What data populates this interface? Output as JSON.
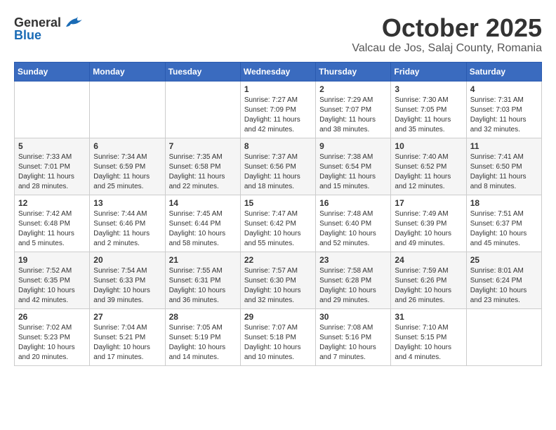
{
  "header": {
    "logo_general": "General",
    "logo_blue": "Blue",
    "month": "October 2025",
    "location": "Valcau de Jos, Salaj County, Romania"
  },
  "weekdays": [
    "Sunday",
    "Monday",
    "Tuesday",
    "Wednesday",
    "Thursday",
    "Friday",
    "Saturday"
  ],
  "weeks": [
    [
      {
        "day": "",
        "info": ""
      },
      {
        "day": "",
        "info": ""
      },
      {
        "day": "",
        "info": ""
      },
      {
        "day": "1",
        "info": "Sunrise: 7:27 AM\nSunset: 7:09 PM\nDaylight: 11 hours\nand 42 minutes."
      },
      {
        "day": "2",
        "info": "Sunrise: 7:29 AM\nSunset: 7:07 PM\nDaylight: 11 hours\nand 38 minutes."
      },
      {
        "day": "3",
        "info": "Sunrise: 7:30 AM\nSunset: 7:05 PM\nDaylight: 11 hours\nand 35 minutes."
      },
      {
        "day": "4",
        "info": "Sunrise: 7:31 AM\nSunset: 7:03 PM\nDaylight: 11 hours\nand 32 minutes."
      }
    ],
    [
      {
        "day": "5",
        "info": "Sunrise: 7:33 AM\nSunset: 7:01 PM\nDaylight: 11 hours\nand 28 minutes."
      },
      {
        "day": "6",
        "info": "Sunrise: 7:34 AM\nSunset: 6:59 PM\nDaylight: 11 hours\nand 25 minutes."
      },
      {
        "day": "7",
        "info": "Sunrise: 7:35 AM\nSunset: 6:58 PM\nDaylight: 11 hours\nand 22 minutes."
      },
      {
        "day": "8",
        "info": "Sunrise: 7:37 AM\nSunset: 6:56 PM\nDaylight: 11 hours\nand 18 minutes."
      },
      {
        "day": "9",
        "info": "Sunrise: 7:38 AM\nSunset: 6:54 PM\nDaylight: 11 hours\nand 15 minutes."
      },
      {
        "day": "10",
        "info": "Sunrise: 7:40 AM\nSunset: 6:52 PM\nDaylight: 11 hours\nand 12 minutes."
      },
      {
        "day": "11",
        "info": "Sunrise: 7:41 AM\nSunset: 6:50 PM\nDaylight: 11 hours\nand 8 minutes."
      }
    ],
    [
      {
        "day": "12",
        "info": "Sunrise: 7:42 AM\nSunset: 6:48 PM\nDaylight: 11 hours\nand 5 minutes."
      },
      {
        "day": "13",
        "info": "Sunrise: 7:44 AM\nSunset: 6:46 PM\nDaylight: 11 hours\nand 2 minutes."
      },
      {
        "day": "14",
        "info": "Sunrise: 7:45 AM\nSunset: 6:44 PM\nDaylight: 10 hours\nand 58 minutes."
      },
      {
        "day": "15",
        "info": "Sunrise: 7:47 AM\nSunset: 6:42 PM\nDaylight: 10 hours\nand 55 minutes."
      },
      {
        "day": "16",
        "info": "Sunrise: 7:48 AM\nSunset: 6:40 PM\nDaylight: 10 hours\nand 52 minutes."
      },
      {
        "day": "17",
        "info": "Sunrise: 7:49 AM\nSunset: 6:39 PM\nDaylight: 10 hours\nand 49 minutes."
      },
      {
        "day": "18",
        "info": "Sunrise: 7:51 AM\nSunset: 6:37 PM\nDaylight: 10 hours\nand 45 minutes."
      }
    ],
    [
      {
        "day": "19",
        "info": "Sunrise: 7:52 AM\nSunset: 6:35 PM\nDaylight: 10 hours\nand 42 minutes."
      },
      {
        "day": "20",
        "info": "Sunrise: 7:54 AM\nSunset: 6:33 PM\nDaylight: 10 hours\nand 39 minutes."
      },
      {
        "day": "21",
        "info": "Sunrise: 7:55 AM\nSunset: 6:31 PM\nDaylight: 10 hours\nand 36 minutes."
      },
      {
        "day": "22",
        "info": "Sunrise: 7:57 AM\nSunset: 6:30 PM\nDaylight: 10 hours\nand 32 minutes."
      },
      {
        "day": "23",
        "info": "Sunrise: 7:58 AM\nSunset: 6:28 PM\nDaylight: 10 hours\nand 29 minutes."
      },
      {
        "day": "24",
        "info": "Sunrise: 7:59 AM\nSunset: 6:26 PM\nDaylight: 10 hours\nand 26 minutes."
      },
      {
        "day": "25",
        "info": "Sunrise: 8:01 AM\nSunset: 6:24 PM\nDaylight: 10 hours\nand 23 minutes."
      }
    ],
    [
      {
        "day": "26",
        "info": "Sunrise: 7:02 AM\nSunset: 5:23 PM\nDaylight: 10 hours\nand 20 minutes."
      },
      {
        "day": "27",
        "info": "Sunrise: 7:04 AM\nSunset: 5:21 PM\nDaylight: 10 hours\nand 17 minutes."
      },
      {
        "day": "28",
        "info": "Sunrise: 7:05 AM\nSunset: 5:19 PM\nDaylight: 10 hours\nand 14 minutes."
      },
      {
        "day": "29",
        "info": "Sunrise: 7:07 AM\nSunset: 5:18 PM\nDaylight: 10 hours\nand 10 minutes."
      },
      {
        "day": "30",
        "info": "Sunrise: 7:08 AM\nSunset: 5:16 PM\nDaylight: 10 hours\nand 7 minutes."
      },
      {
        "day": "31",
        "info": "Sunrise: 7:10 AM\nSunset: 5:15 PM\nDaylight: 10 hours\nand 4 minutes."
      },
      {
        "day": "",
        "info": ""
      }
    ]
  ]
}
